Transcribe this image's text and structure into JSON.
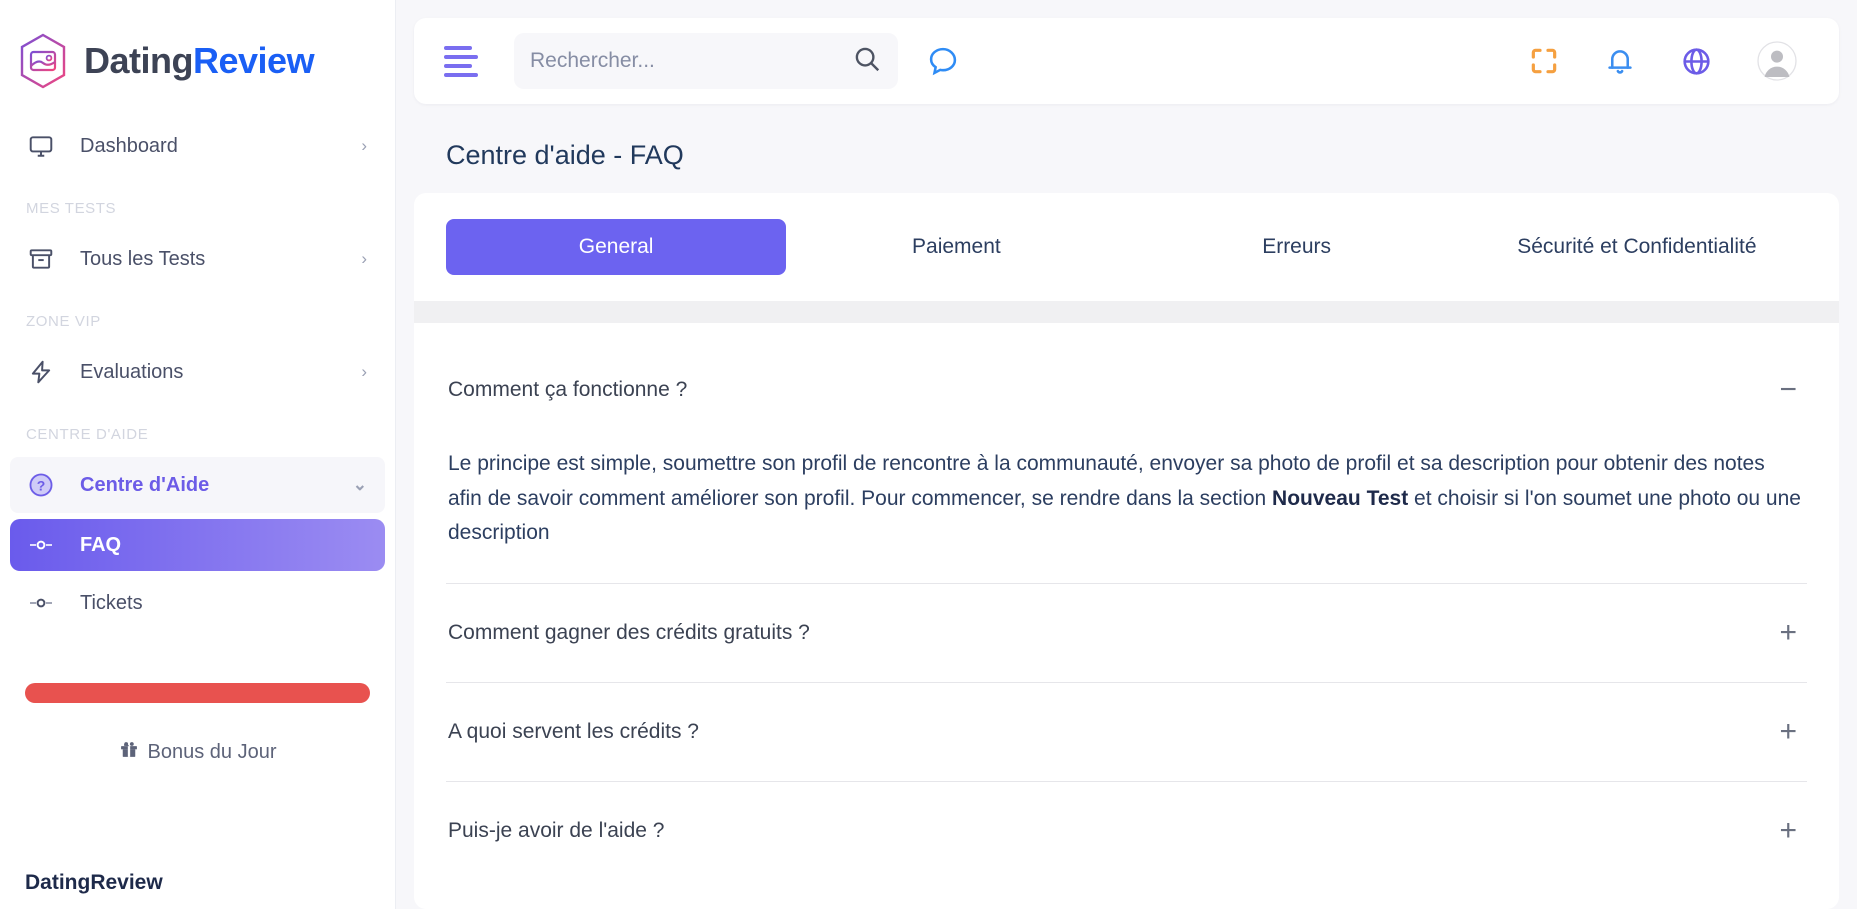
{
  "brand": {
    "name_part1": "Dating",
    "name_part2": "Review",
    "footer_name": "DatingReview",
    "logo_icon": "photo-hexagon-icon",
    "accent_purple": "#6c63f0",
    "accent_blue": "#1a5ff5",
    "accent_red": "#e8524f",
    "accent_orange": "#f5a040"
  },
  "sidebar": {
    "items": [
      {
        "label": "Dashboard",
        "icon": "monitor-icon",
        "chevron": "›"
      }
    ],
    "groups": [
      {
        "label": "MES TESTS",
        "items": [
          {
            "label": "Tous les Tests",
            "icon": "archive-box-icon",
            "chevron": "›"
          }
        ]
      },
      {
        "label": "ZONE VIP",
        "items": [
          {
            "label": "Evaluations",
            "icon": "lightning-bolt-icon",
            "chevron": "›"
          }
        ]
      },
      {
        "label": "CENTRE D'AIDE",
        "items": [
          {
            "label": "Centre d'Aide",
            "icon": "question-circle-icon",
            "chevron": "⌄"
          }
        ]
      }
    ],
    "sub_items": [
      {
        "label": "FAQ",
        "icon": "dot-marker-icon",
        "active": true
      },
      {
        "label": "Tickets",
        "icon": "dot-marker-icon",
        "active": false
      }
    ],
    "bonus": {
      "label": "Bonus du Jour",
      "icon": "gift-icon"
    }
  },
  "topbar": {
    "menu_icon": "hamburger-menu-icon",
    "search": {
      "placeholder": "Rechercher...",
      "value": "",
      "icon": "search-icon"
    },
    "chat_icon": "chat-bubble-icon",
    "icons": [
      {
        "name": "fullscreen-icon",
        "color": "#f5a040"
      },
      {
        "name": "bell-icon",
        "color": "#3b8ef0"
      },
      {
        "name": "globe-icon",
        "color": "#6c5ce7"
      },
      {
        "name": "avatar-icon",
        "color": "#bfbfbf"
      }
    ]
  },
  "page": {
    "title": "Centre d'aide - FAQ"
  },
  "tabs": [
    {
      "label": "General",
      "active": true
    },
    {
      "label": "Paiement",
      "active": false
    },
    {
      "label": "Erreurs",
      "active": false
    },
    {
      "label": "Sécurité et Confidentialité",
      "active": false
    }
  ],
  "faq": [
    {
      "question": "Comment ça fonctionne ?",
      "sign": "−",
      "expanded": true,
      "answer_part1": "Le principe est simple, soumettre son profil de rencontre à la communauté, envoyer sa photo de profil et sa description pour obtenir des notes afin de savoir comment améliorer son profil. Pour commencer, se rendre dans la section ",
      "answer_bold": "Nouveau Test",
      "answer_part2": " et choisir si l'on soumet une photo ou une description"
    },
    {
      "question": "Comment gagner des crédits gratuits ?",
      "sign": "+",
      "expanded": false
    },
    {
      "question": "A quoi servent les crédits ?",
      "sign": "+",
      "expanded": false
    },
    {
      "question": "Puis-je avoir de l'aide ?",
      "sign": "+",
      "expanded": false
    }
  ]
}
